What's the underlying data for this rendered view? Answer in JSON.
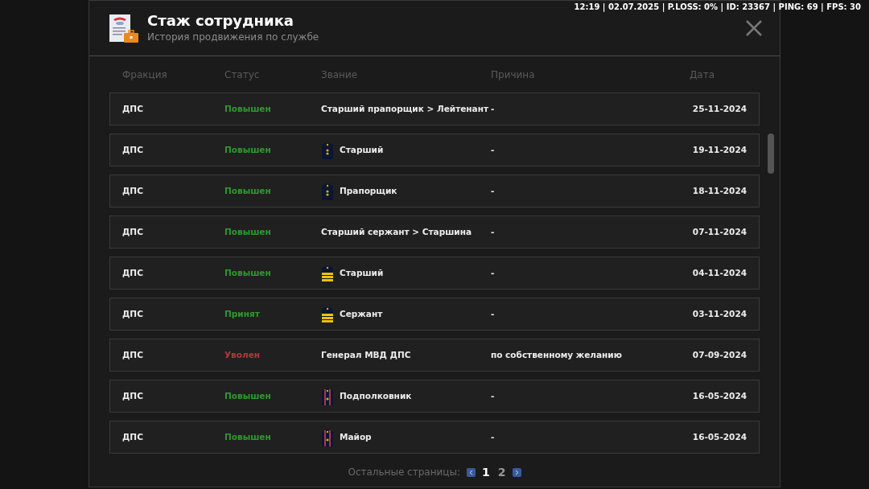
{
  "hud": {
    "status_line": "12:19 | 02.07.2025 | P.LOSS: 0% | ID: 23367 | PING: 69 | FPS: 30"
  },
  "window": {
    "title": "Стаж сотрудника",
    "subtitle": "История продвижения по службе"
  },
  "table": {
    "columns": [
      "Фракция",
      "Статус",
      "Звание",
      "Причина",
      "Дата"
    ],
    "rows": [
      {
        "kind": "text",
        "faction": "ДПС",
        "status": {
          "label": "Повышен",
          "color": "#2e9a2e"
        },
        "rank": "Старший прапорщик > Лейтенант",
        "reason": "-",
        "date": "25-11-2024"
      },
      {
        "kind": "stars",
        "faction": "ДПС",
        "status": {
          "label": "Повышен",
          "color": "#2e9a2e"
        },
        "rank": "Старший",
        "reason": "-",
        "date": "19-11-2024"
      },
      {
        "kind": "stars",
        "faction": "ДПС",
        "status": {
          "label": "Повышен",
          "color": "#2e9a2e"
        },
        "rank": "Прапорщик",
        "reason": "-",
        "date": "18-11-2024"
      },
      {
        "kind": "text",
        "faction": "ДПС",
        "status": {
          "label": "Повышен",
          "color": "#2e9a2e"
        },
        "rank": "Старший сержант > Старшина",
        "reason": "-",
        "date": "07-11-2024"
      },
      {
        "kind": "stripes",
        "faction": "ДПС",
        "status": {
          "label": "Повышен",
          "color": "#2e9a2e"
        },
        "rank": "Старший",
        "reason": "-",
        "date": "04-11-2024"
      },
      {
        "kind": "stripes",
        "faction": "ДПС",
        "status": {
          "label": "Принят",
          "color": "#2e9a2e"
        },
        "rank": "Сержант",
        "reason": "-",
        "date": "03-11-2024"
      },
      {
        "kind": "text",
        "faction": "ДПС",
        "status": {
          "label": "Уволен",
          "color": "#b03a3a"
        },
        "rank": "Генерал МВД ДПС",
        "reason": "по собственному желанию",
        "date": "07-09-2024"
      },
      {
        "kind": "officer",
        "faction": "ДПС",
        "status": {
          "label": "Повышен",
          "color": "#2e9a2e"
        },
        "rank": "Подполковник",
        "reason": "-",
        "date": "16-05-2024"
      },
      {
        "kind": "officer",
        "faction": "ДПС",
        "status": {
          "label": "Повышен",
          "color": "#2e9a2e"
        },
        "rank": "Майор",
        "reason": "-",
        "date": "16-05-2024"
      }
    ]
  },
  "pagination": {
    "label": "Остальные страницы:",
    "pages": [
      {
        "label": "1",
        "selected": true
      },
      {
        "label": "2",
        "selected": false
      }
    ]
  }
}
